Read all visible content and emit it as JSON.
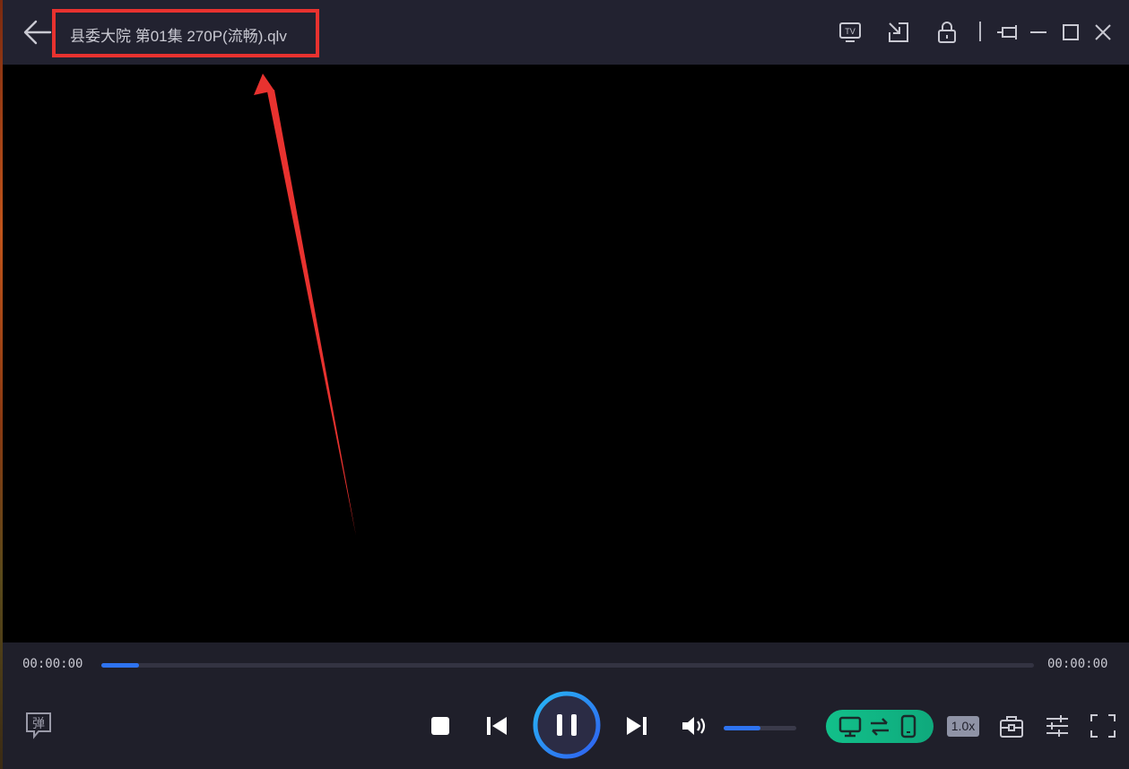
{
  "titlebar": {
    "title": "县委大院 第01集 270P(流畅).qlv",
    "icons": [
      "back-arrow-icon",
      "tv-icon",
      "mini-window-icon",
      "lock-icon",
      "pin-icon",
      "minimize-icon",
      "maximize-icon",
      "close-icon"
    ],
    "tv_label": "TV"
  },
  "player": {
    "current_time": "00:00:00",
    "total_time": "00:00:00",
    "progress": 0.04,
    "volume": 0.5,
    "speed": "1.0x",
    "danmaku_label": "弹"
  },
  "colors": {
    "accent": "#2e73f0",
    "highlight_box": "#e8322f",
    "cast_green": "#12c08a",
    "background": "#1f1f2a"
  }
}
